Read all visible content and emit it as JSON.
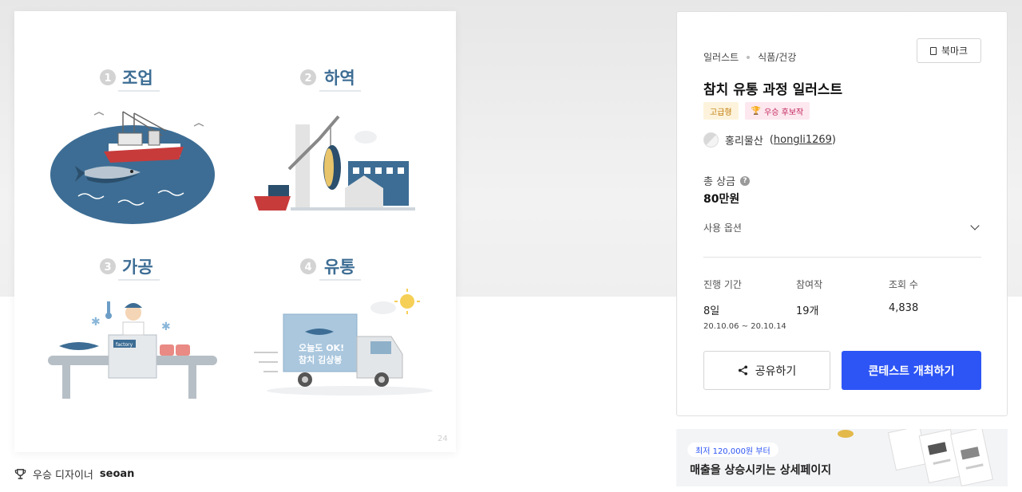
{
  "artwork": {
    "sections": [
      {
        "number": "1",
        "label": "조업"
      },
      {
        "number": "2",
        "label": "하역"
      },
      {
        "number": "3",
        "label": "가공"
      },
      {
        "number": "4",
        "label": "유통"
      }
    ],
    "factory_sign": "factory",
    "truck_text_line1": "오늘도 OK!",
    "truck_text_line2": "참치 김상봉",
    "corner_mark": "24"
  },
  "winner": {
    "prefix": "우승 디자이너",
    "name": "seoan"
  },
  "contest": {
    "breadcrumb": [
      "일러스트",
      "식품/건강"
    ],
    "bookmark_label": "북마크",
    "title": "참치 유통 과정 일러스트",
    "badges": {
      "premium": "고급형",
      "candidate": "우승 후보작"
    },
    "author": {
      "name": "홍리물산",
      "handle": "hongli1269"
    },
    "prize": {
      "label": "총 상금",
      "value": "80만원"
    },
    "options_label": "사용 옵션",
    "stats": {
      "period": {
        "label": "진행 기간",
        "value": "8일",
        "range": "20.10.06 ~ 20.10.14"
      },
      "participants": {
        "label": "참여작",
        "value": "19개"
      },
      "views": {
        "label": "조회 수",
        "value": "4,838"
      }
    },
    "share_label": "공유하기",
    "host_label": "콘테스트 개최하기"
  },
  "banner": {
    "pill": "최저 120,000원 부터",
    "headline": "매출을 상승시키는 상세페이지"
  },
  "colors": {
    "primary": "#2d55f5",
    "illustration_navy": "#3d6d94",
    "premium_badge": "#c07a06",
    "candidate_badge": "#c2255c"
  }
}
